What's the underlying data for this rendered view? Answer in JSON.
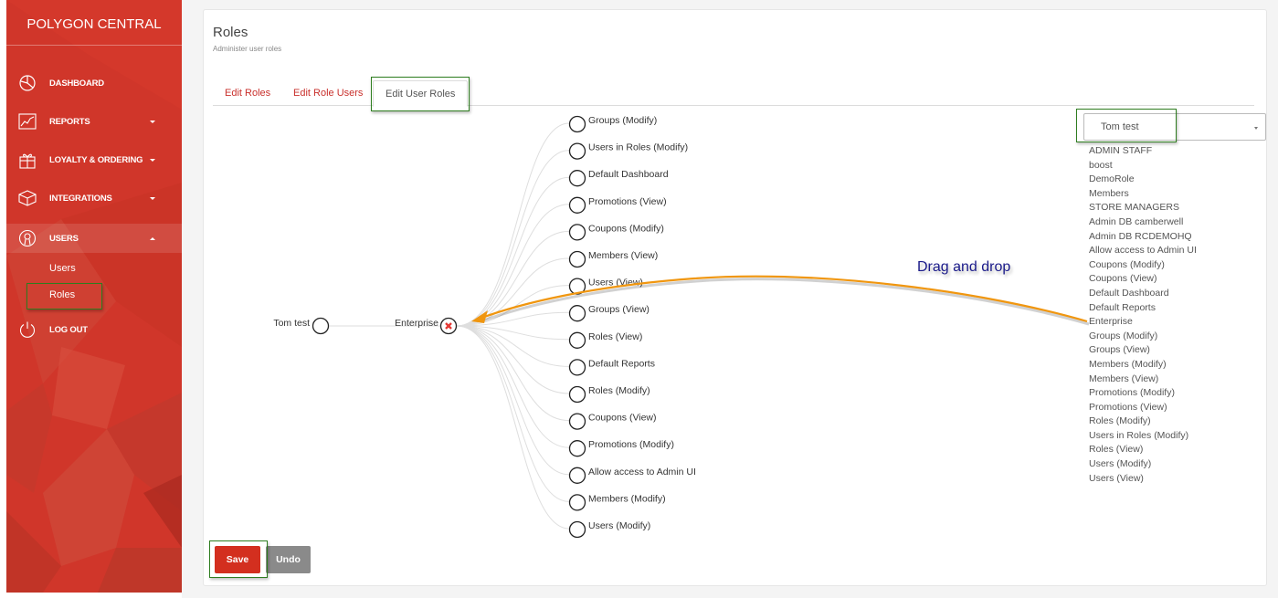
{
  "sidebar": {
    "brand": "POLYGON CENTRAL",
    "items": [
      {
        "label": "DASHBOARD",
        "icon": "pie-chart-icon",
        "caret": "none"
      },
      {
        "label": "REPORTS",
        "icon": "line-chart-icon",
        "caret": "down"
      },
      {
        "label": "LOYALTY & ORDERING",
        "icon": "gift-icon",
        "caret": "down"
      },
      {
        "label": "INTEGRATIONS",
        "icon": "cube-icon",
        "caret": "down"
      },
      {
        "label": "USERS",
        "icon": "user-icon",
        "caret": "up",
        "active": true
      },
      {
        "label": "LOG OUT",
        "icon": "power-icon",
        "caret": "none"
      }
    ],
    "sub_items": [
      {
        "label": "Users"
      },
      {
        "label": "Roles",
        "selected": true
      }
    ],
    "colors": {
      "background": "#d0362a"
    }
  },
  "header": {
    "title": "Roles",
    "subtitle": "Administer user roles"
  },
  "tabs": [
    {
      "label": "Edit Roles",
      "active": false
    },
    {
      "label": "Edit Role Users",
      "active": false
    },
    {
      "label": "Edit User Roles",
      "active": true
    }
  ],
  "graph": {
    "user_node": {
      "label": "Tom test"
    },
    "role_node": {
      "label": "Enterprise",
      "remove_icon": "close-icon"
    },
    "permissions": [
      "Groups (Modify)",
      "Users in Roles (Modify)",
      "Default Dashboard",
      "Promotions (View)",
      "Coupons (Modify)",
      "Members (View)",
      "Users (View)",
      "Groups (View)",
      "Roles (View)",
      "Default Reports",
      "Roles (Modify)",
      "Coupons (View)",
      "Promotions (Modify)",
      "Allow access to Admin UI",
      "Members (Modify)",
      "Users (Modify)"
    ]
  },
  "user_select": {
    "value": "Tom test"
  },
  "available_roles": [
    "ADMIN STAFF",
    "boost",
    "DemoRole",
    "Members",
    "STORE MANAGERS",
    "Admin DB camberwell",
    "Admin DB RCDEMOHQ",
    "Allow access to Admin UI",
    "Coupons (Modify)",
    "Coupons (View)",
    "Default Dashboard",
    "Default Reports",
    "Enterprise",
    "Groups (Modify)",
    "Groups (View)",
    "Members (Modify)",
    "Members (View)",
    "Promotions (Modify)",
    "Promotions (View)",
    "Roles (Modify)",
    "Users in Roles (Modify)",
    "Roles (View)",
    "Users (Modify)",
    "Users (View)"
  ],
  "annotation": {
    "text": "Drag and drop",
    "arrow_color": "#f0960f",
    "text_color": "#1a1a8a"
  },
  "actions": {
    "save_label": "Save",
    "undo_label": "Undo"
  },
  "colors": {
    "accent": "#d32f1f",
    "tab_link": "#c9302c",
    "highlight": "#2e7d1f",
    "undo": "#8a8a8a"
  }
}
